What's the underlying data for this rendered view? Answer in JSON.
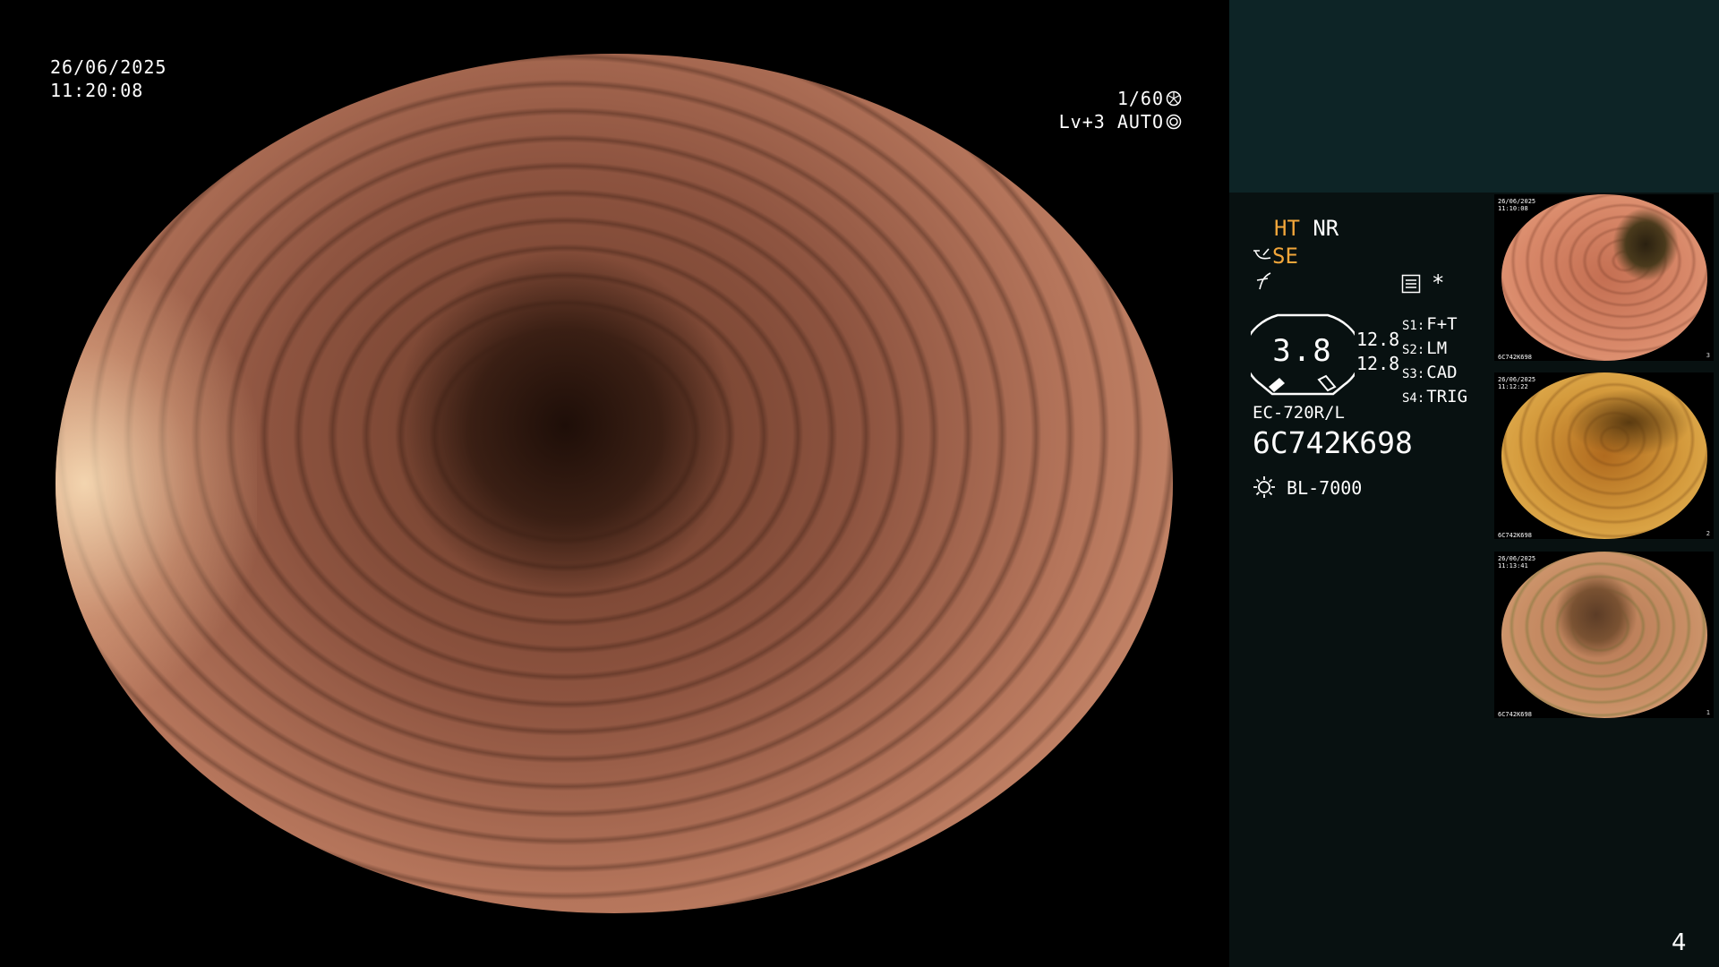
{
  "overlay": {
    "date": "26/06/2025",
    "time": "11:20:08",
    "shutter": "1/60",
    "shutter_icon": "shutter-icon",
    "iris_level": "Lv+3",
    "iris_mode": "AUTO",
    "iris_icon": "iris-icon"
  },
  "panel": {
    "mode_ht": "HT",
    "mode_nr": "NR",
    "se_label": "SE",
    "se_icon": "structure-enhance-icon",
    "freeze_icon": "freeze-icon",
    "memo_icon": "memo-icon",
    "asterisk": "*",
    "gauge_value": "3.8",
    "readout_1": "12.8",
    "readout_2": "12.8",
    "switches": [
      {
        "key": "S1:",
        "value": "F+T"
      },
      {
        "key": "S2:",
        "value": "LM"
      },
      {
        "key": "S3:",
        "value": "CAD"
      },
      {
        "key": "S4:",
        "value": "TRIG"
      }
    ],
    "scope_model": "EC-720R/L",
    "scope_serial": "6C742K698",
    "light_icon": "light-source-icon",
    "light_source": "BL-7000",
    "accent_color": "#f2a63a",
    "panel_top_color": "#0d2426",
    "panel_color": "#081111"
  },
  "thumbnails": [
    {
      "date": "26/06/2025",
      "time": "11:10:08",
      "serial": "6C742K698",
      "number": "3"
    },
    {
      "date": "26/06/2025",
      "time": "11:12:22",
      "serial": "6C742K698",
      "number": "2"
    },
    {
      "date": "26/06/2025",
      "time": "11:13:41",
      "serial": "6C742K698",
      "number": "1"
    }
  ],
  "page_number": "4"
}
